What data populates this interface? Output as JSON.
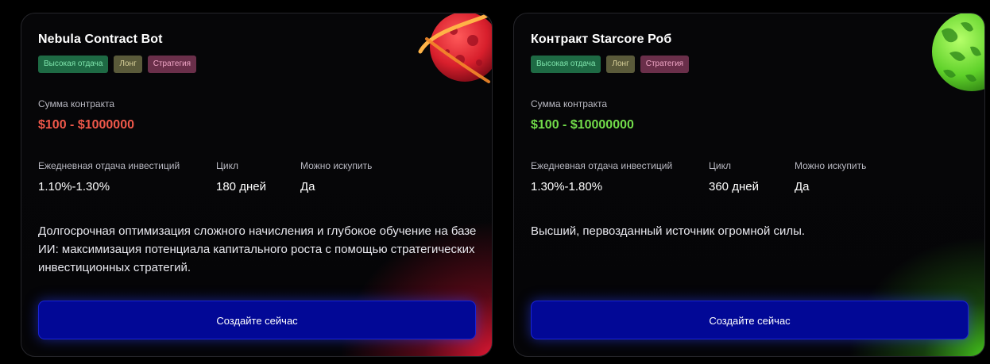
{
  "cards": [
    {
      "title": "Nebula Contract Bot",
      "tags": [
        "Высокая отдача",
        "Лонг",
        "Стратегия"
      ],
      "sum_label": "Сумма контракта",
      "sum_value": "$100 - $1000000",
      "stats": [
        {
          "label": "Ежедневная отдача инвестиций",
          "value": "1.10%-1.30%"
        },
        {
          "label": "Цикл",
          "value": "180 дней"
        },
        {
          "label": "Можно искупить",
          "value": "Да"
        }
      ],
      "description": "Долгосрочная оптимизация сложного начисления и глубокое обучение на базе ИИ: максимизация потенциала капитального роста с помощью стратегических инвестиционных стратегий.",
      "button_label": "Создайте сейчас",
      "accent_color": "#f0584a",
      "planet_icon": "red-planet-icon"
    },
    {
      "title": "Контракт Starcore Роб",
      "tags": [
        "Высокая отдача",
        "Лонг",
        "Стратегия"
      ],
      "sum_label": "Сумма контракта",
      "sum_value": "$100 - $10000000",
      "stats": [
        {
          "label": "Ежедневная отдача инвестиций",
          "value": "1.30%-1.80%"
        },
        {
          "label": "Цикл",
          "value": "360 дней"
        },
        {
          "label": "Можно искупить",
          "value": "Да"
        }
      ],
      "description": "Высший, первозданный источник огромной силы.",
      "button_label": "Создайте сейчас",
      "accent_color": "#72dc4a",
      "planet_icon": "green-planet-icon"
    }
  ],
  "colors": {
    "background": "#000000",
    "button": "#020896",
    "tag_high_return": "#1e6a44",
    "tag_long": "#5a5a3a",
    "tag_strategy": "#6a2f4a"
  }
}
